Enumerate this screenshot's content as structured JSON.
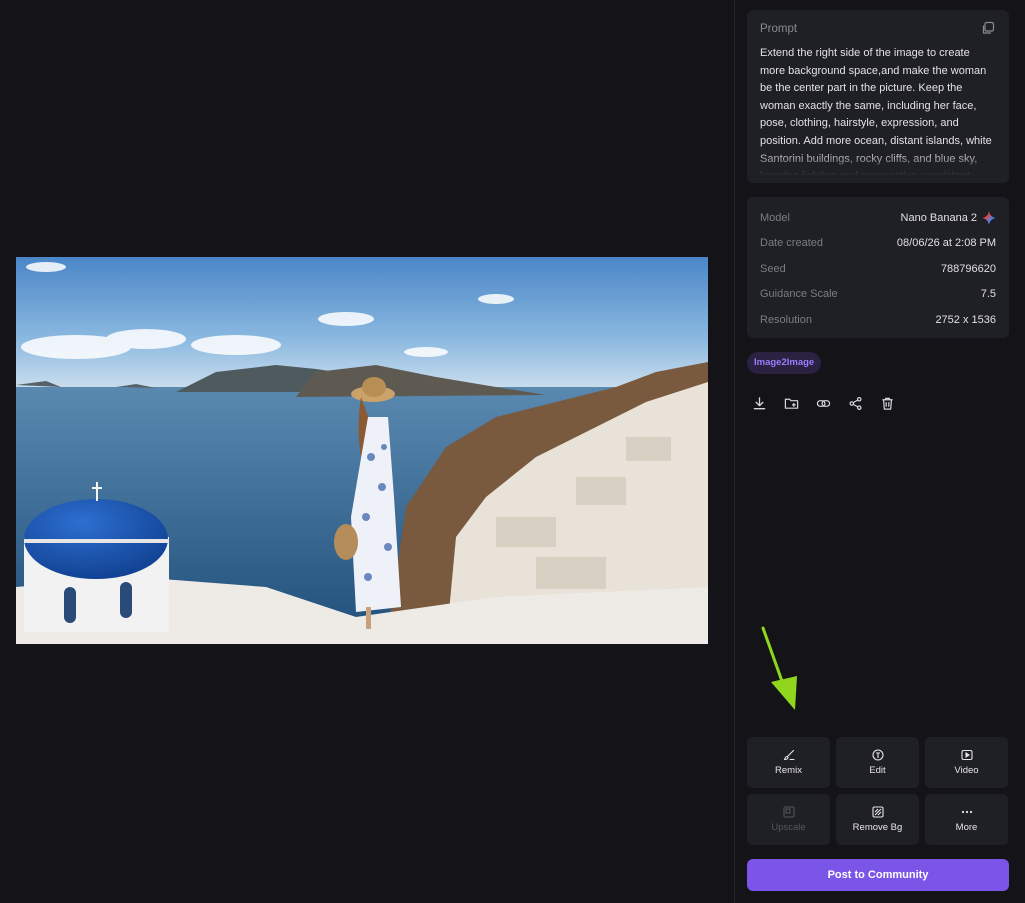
{
  "prompt": {
    "label": "Prompt",
    "text": "Extend the right side of the image to create more background space,and make the woman be the center part in the picture. Keep the woman exactly the same, including her face, pose, clothing, hairstyle, expression, and position. Add more ocean, distant islands, white Santorini buildings, rocky cliffs, and blue sky, keeping lighting and perspective consistent."
  },
  "meta": {
    "model_label": "Model",
    "model_value": "Nano Banana 2",
    "date_label": "Date created",
    "date_value": "08/06/26 at 2:08 PM",
    "seed_label": "Seed",
    "seed_value": "788796620",
    "guidance_label": "Guidance Scale",
    "guidance_value": "7.5",
    "resolution_label": "Resolution",
    "resolution_value": "2752 x 1536"
  },
  "tag": "Image2Image",
  "tools": {
    "remix": "Remix",
    "edit": "Edit",
    "video": "Video",
    "upscale": "Upscale",
    "remove_bg": "Remove Bg",
    "more": "More"
  },
  "post_button": "Post to Community",
  "colors": {
    "background": "#131318",
    "card": "#1f1f26",
    "accent": "#7b54e8",
    "tag_text": "#9b7cff",
    "arrow": "#8fd61c"
  },
  "icons": [
    "copy-icon",
    "gemini-icon",
    "download-icon",
    "folder-add-icon",
    "link-icon",
    "share-icon",
    "trash-icon",
    "brush-icon",
    "edit-icon",
    "video-icon",
    "upscale-icon",
    "remove-bg-icon",
    "more-icon"
  ]
}
